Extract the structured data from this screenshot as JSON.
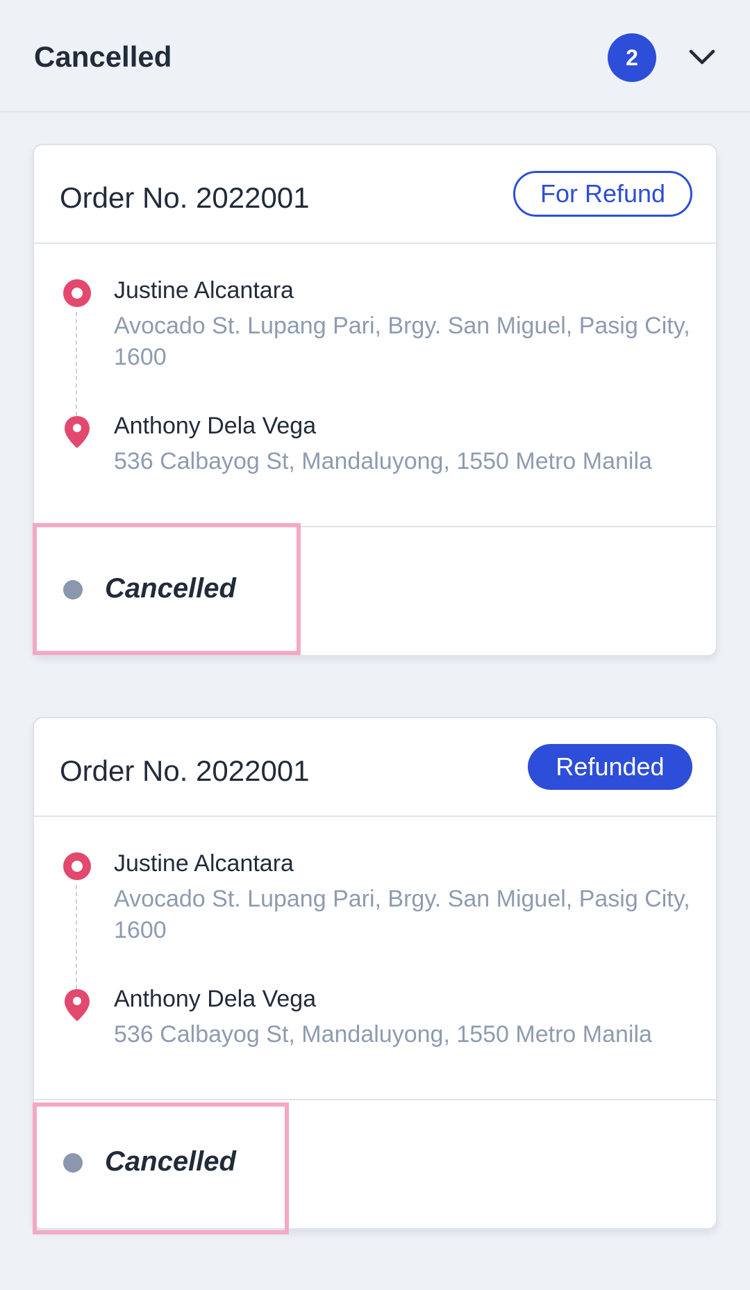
{
  "header": {
    "title": "Cancelled",
    "count": "2"
  },
  "orders": [
    {
      "order_no": "Order No. 2022001",
      "badge": "For Refund",
      "pickup_name": "Justine Alcantara",
      "pickup_address": "Avocado St. Lupang Pari, Brgy. San Miguel, Pasig City, 1600",
      "dropoff_name": "Anthony Dela Vega",
      "dropoff_address": "536 Calbayog St, Mandaluyong, 1550 Metro Manila",
      "status": "Cancelled"
    },
    {
      "order_no": "Order No. 2022001",
      "badge": "Refunded",
      "pickup_name": "Justine Alcantara",
      "pickup_address": "Avocado St. Lupang Pari, Brgy. San Miguel, Pasig City, 1600",
      "dropoff_name": "Anthony Dela Vega",
      "dropoff_address": "536 Calbayog St, Mandaluyong, 1550 Metro Manila",
      "status": "Cancelled"
    }
  ],
  "colors": {
    "accent": "#2d4ed8",
    "pin": "#e3486e",
    "status_dot": "#8a97ad",
    "highlight": "#f5a8c4",
    "background": "#eef1f6"
  },
  "icons": {
    "expand": "chevron-down-icon",
    "pickup": "pickup-pin-icon",
    "dropoff": "location-pin-icon"
  }
}
